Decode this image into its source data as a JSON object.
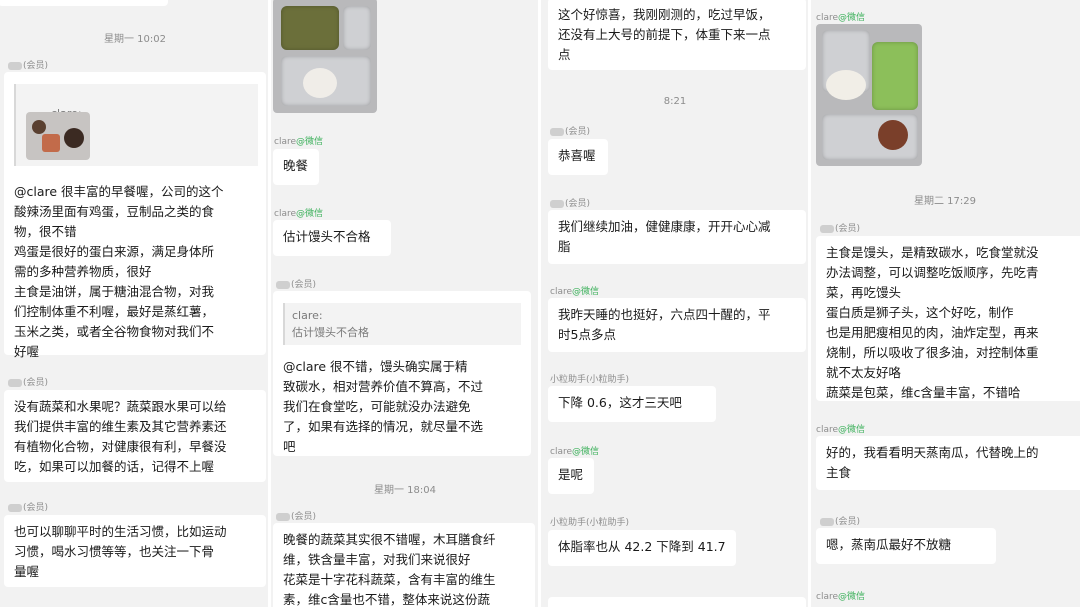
{
  "columns": [
    {
      "items": [
        {
          "kind": "bubble",
          "text": ""
        },
        {
          "kind": "time",
          "text": "星期一 10:02"
        },
        {
          "kind": "sender",
          "name": "(会员)"
        },
        {
          "kind": "quote",
          "text": "clare:"
        },
        {
          "kind": "bubble",
          "text": "@clare 很丰富的早餐喔，公司的这个\n酸辣汤里面有鸡蛋，豆制品之类的食\n物，很不错\n鸡蛋是很好的蛋白来源，满足身体所\n需的多种营养物质，很好\n主食是油饼，属于糖油混合物，对我\n们控制体重不利喔，最好是蒸红薯，\n玉米之类，或者全谷物食物对我们不\n好喔"
        },
        {
          "kind": "sender",
          "name": "(会员)"
        },
        {
          "kind": "bubble",
          "text": "没有蔬菜和水果呢？蔬菜跟水果可以给\n我们提供丰富的维生素及其它营养素还\n有植物化合物，对健康很有利，早餐没\n吃，如果可以加餐的话，记得不上喔"
        },
        {
          "kind": "sender",
          "name": "(会员)"
        },
        {
          "kind": "bubble",
          "text": "也可以聊聊平时的生活习惯，比如运动\n习惯，喝水习惯等等，也关注一下骨\n量喔"
        }
      ]
    },
    {
      "items": [
        {
          "kind": "sender",
          "name": "clare",
          "wx": "@微信"
        },
        {
          "kind": "bubble",
          "text": "晚餐"
        },
        {
          "kind": "sender",
          "name": "clare",
          "wx": "@微信"
        },
        {
          "kind": "bubble",
          "text": "估计馒头不合格"
        },
        {
          "kind": "sender",
          "name": "(会员)"
        },
        {
          "kind": "quote",
          "text": "clare:\n估计馒头不合格"
        },
        {
          "kind": "bubble",
          "text": "@clare 很不错，馒头确实属于精\n致碳水，相对营养价值不算高，不过\n我们在食堂吃，可能就没办法避免\n了，如果有选择的情况，就尽量不选\n吧"
        },
        {
          "kind": "time",
          "text": "星期一 18:04"
        },
        {
          "kind": "sender",
          "name": "(会员)"
        },
        {
          "kind": "bubble",
          "text": "晚餐的蔬菜其实很不错喔，木耳膳食纤\n维，铁含量丰富，对我们来说很好\n花菜是十字花科蔬菜，含有丰富的维生\n素，维c含量也不错，整体来说这份蔬"
        }
      ]
    },
    {
      "items": [
        {
          "kind": "bubble",
          "text": "这个好惊喜，我刚刚测的，吃过早饭，\n还没有上大号的前提下，体重下来一点\n点"
        },
        {
          "kind": "time",
          "text": "8:21"
        },
        {
          "kind": "sender",
          "name": "(会员)"
        },
        {
          "kind": "bubble",
          "text": "恭喜喔"
        },
        {
          "kind": "sender",
          "name": "(会员)"
        },
        {
          "kind": "bubble",
          "text": "我们继续加油，健健康康，开开心心减\n脂"
        },
        {
          "kind": "sender",
          "name": "clare",
          "wx": "@微信"
        },
        {
          "kind": "bubble",
          "text": "我昨天睡的也挺好，六点四十醒的，平\n时5点多点"
        },
        {
          "kind": "sender",
          "name": "小粒助手(小粒助手)"
        },
        {
          "kind": "bubble",
          "text": "下降 0.6，这才三天吧"
        },
        {
          "kind": "sender",
          "name": "clare",
          "wx": "@微信"
        },
        {
          "kind": "bubble",
          "text": "是呢"
        },
        {
          "kind": "sender",
          "name": "小粒助手(小粒助手)"
        },
        {
          "kind": "bubble",
          "text": "体脂率也从 42.2 下降到 41.7"
        }
      ]
    },
    {
      "items": [
        {
          "kind": "sender",
          "name": "clare",
          "wx": "@微信"
        },
        {
          "kind": "time",
          "text": "星期二 17:29"
        },
        {
          "kind": "sender",
          "name": "(会员)"
        },
        {
          "kind": "bubble",
          "text": "主食是馒头，是精致碳水，吃食堂就没\n办法调整，可以调整吃饭顺序，先吃青\n菜，再吃馒头\n蛋白质是狮子头，这个好吃，制作\n也是用肥瘦相见的肉，油炸定型，再来\n烧制，所以吸收了很多油，对控制体重\n就不太友好咯\n蔬菜是包菜，维c含量丰富，不错哈"
        },
        {
          "kind": "sender",
          "name": "clare",
          "wx": "@微信"
        },
        {
          "kind": "bubble",
          "text": "好的，我看看明天蒸南瓜，代替晚上的\n主食"
        },
        {
          "kind": "sender",
          "name": "(会员)"
        },
        {
          "kind": "bubble",
          "text": "嗯，蒸南瓜最好不放糖"
        },
        {
          "kind": "sender",
          "name": "clare",
          "wx": "@微信"
        }
      ]
    }
  ]
}
